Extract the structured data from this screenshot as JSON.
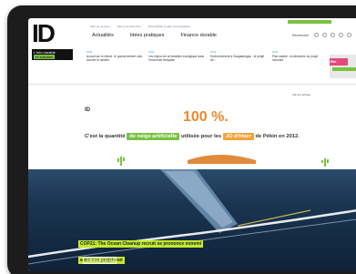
{
  "logo": {
    "text": "ID",
    "badge_line1": "L'info durable",
    "badge_line2": "et solidaire"
  },
  "topnav_small": [
    "Aller au contenu",
    "Aller à la recherche",
    "Accessibilité et aide à la navigation"
  ],
  "mainnav": [
    "Actualités",
    "Idées pratiques",
    "Finance durable"
  ],
  "search": {
    "label": "Rechercher"
  },
  "news": [
    {
      "date": "04/12",
      "text": "Accord sur le climat : le gouvernement veut boucler le dossier"
    },
    {
      "date": "04/12",
      "text": "Les enjeux de la transition écologique dans l'économie française"
    },
    {
      "date": "03/12",
      "text": "Environnement à Ouagadougou : le projet de ..."
    },
    {
      "date": "03/12",
      "text": "Plan solaire : la démarche du projet innovant"
    }
  ],
  "news_thumb": {
    "label": "Bio"
  },
  "small_link": "Voir les articles",
  "infographic": {
    "mini_logo": "ID",
    "percent": "100 %.",
    "sentence_before": "C'est la quantité",
    "highlight1": "de neige artificielle",
    "sentence_mid": "utilisée pour les",
    "highlight2": "JO d'hiver",
    "sentence_after": "de Pékin en 2012."
  },
  "hero": {
    "caption_line1": "COP21: The Ocean Cleanup recruit se prononce ennemi",
    "caption_line2": "avec son projet osé",
    "button": "EN SAVOIR PLUS"
  },
  "colors": {
    "accent_green": "#7ac142",
    "accent_orange": "#e88a2d",
    "caption_yellow": "#c6e92b"
  }
}
